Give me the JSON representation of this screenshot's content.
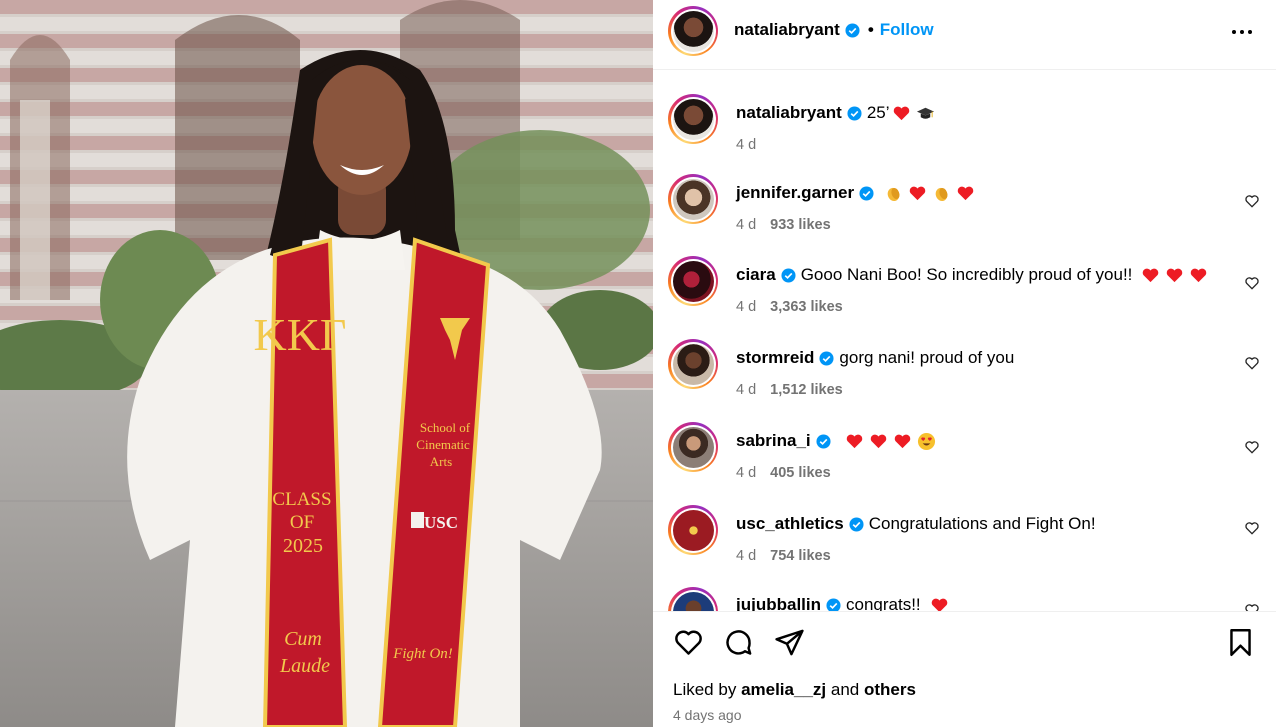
{
  "post": {
    "author": "nataliabryant",
    "follow_label": "Follow",
    "separator": "•",
    "caption_text": "25’",
    "caption_time": "4 d"
  },
  "comments": [
    {
      "user": "jennifer.garner",
      "text": "",
      "time": "4 d",
      "likes": "933 likes",
      "emojis": [
        "clap",
        "heart",
        "clap",
        "heart"
      ]
    },
    {
      "user": "ciara",
      "text": "Gooo Nani Boo! So incredibly proud of you!!",
      "time": "4 d",
      "likes": "3,363 likes",
      "emojis": [
        "heart",
        "heart",
        "heart"
      ]
    },
    {
      "user": "stormreid",
      "text": "gorg nani! proud of you",
      "time": "4 d",
      "likes": "1,512 likes",
      "emojis": []
    },
    {
      "user": "sabrina_i",
      "text": "",
      "time": "4 d",
      "likes": "405 likes",
      "emojis": [
        "heart",
        "heart",
        "heart",
        "heart-eyes"
      ]
    },
    {
      "user": "usc_athletics",
      "text": "Congratulations and Fight On!",
      "time": "4 d",
      "likes": "754 likes",
      "emojis": []
    },
    {
      "user": "jujubballin",
      "text": "congrats!!",
      "time": "",
      "likes": "",
      "emojis": [
        "heart"
      ]
    }
  ],
  "footer": {
    "liked_by_prefix": "Liked by",
    "liked_by_user": "amelia__zj",
    "liked_by_and": "and",
    "liked_by_others": "others",
    "time_ago": "4 days ago"
  },
  "stole": {
    "left_letters": "ΚΚΓ",
    "class_text": "CLASS",
    "of_text": "OF",
    "year_text": "2025",
    "cum_text": "Cum",
    "laude_text": "Laude",
    "school_line1": "School of",
    "school_line2": "Cinematic",
    "school_line3": "Arts",
    "usc_text": "USC",
    "fight_text": "Fight On!"
  },
  "colors": {
    "accent": "#0095f6",
    "verified": "#0095f6",
    "heart": "#ed1c24",
    "stole_red": "#c0182a",
    "stole_gold": "#f2c94c"
  },
  "icons": [
    "verified-badge-icon",
    "more-options-icon",
    "heart-icon",
    "comment-icon",
    "share-icon",
    "bookmark-icon"
  ]
}
